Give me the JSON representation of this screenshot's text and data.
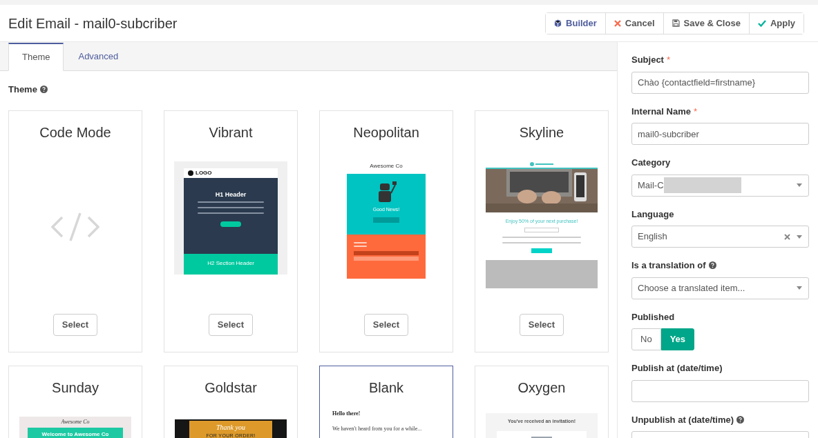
{
  "header": {
    "title": "Edit Email - mail0-subcriber",
    "buttons": [
      {
        "kind": "builder",
        "label": "Builder"
      },
      {
        "kind": "cancel",
        "label": "Cancel"
      },
      {
        "kind": "save",
        "label": "Save & Close"
      },
      {
        "kind": "apply",
        "label": "Apply"
      }
    ]
  },
  "tabs": [
    {
      "label": "Theme",
      "selected": true
    },
    {
      "label": "Advanced",
      "selected": false
    }
  ],
  "theme_label": "Theme",
  "themes": [
    {
      "name": "Code Mode",
      "kind": "code",
      "selected": false,
      "button": "Select"
    },
    {
      "name": "Vibrant",
      "kind": "vibrant",
      "selected": false,
      "button": "Select",
      "texts": [
        "LOGO",
        "H1 Header",
        "H2 Section Header"
      ]
    },
    {
      "name": "Neopolitan",
      "kind": "neopolitan",
      "selected": false,
      "button": "Select",
      "texts": [
        "Awesome Co",
        "Good News!"
      ]
    },
    {
      "name": "Skyline",
      "kind": "skyline",
      "selected": false,
      "button": "Select",
      "texts": [
        "Enjoy 50% of your next purchase!"
      ]
    },
    {
      "name": "Sunday",
      "kind": "sunday",
      "selected": false,
      "texts": [
        "Awesome Co",
        "Welcome to Awesome Co"
      ]
    },
    {
      "name": "Goldstar",
      "kind": "goldstar",
      "selected": false,
      "texts": [
        "Thank you",
        "FOR YOUR ORDER!"
      ]
    },
    {
      "name": "Blank",
      "kind": "blank",
      "selected": true,
      "texts": [
        "Hello there!",
        "We haven't heard from you for a while..."
      ]
    },
    {
      "name": "Oxygen",
      "kind": "oxygen",
      "selected": false,
      "texts": [
        "You've received an invitation!"
      ]
    }
  ],
  "form": [
    {
      "kind": "text",
      "label": "Subject",
      "required_mark": "*",
      "value": "Chào {contactfield=firstname}"
    },
    {
      "kind": "text",
      "label": "Internal Name",
      "required_mark": "*",
      "value": "mail0-subcriber"
    },
    {
      "kind": "select",
      "label": "Category",
      "value": "Mail-C",
      "redacted": true
    },
    {
      "kind": "select",
      "label": "Language",
      "value": "English",
      "clearable": true
    },
    {
      "kind": "select",
      "label": "Is a translation of",
      "help": true,
      "placeholder": "Choose a translated item..."
    },
    {
      "kind": "toggle",
      "label": "Published",
      "options": [
        {
          "label": "No",
          "selected": false
        },
        {
          "label": "Yes",
          "selected": true
        }
      ]
    },
    {
      "kind": "text",
      "label": "Publish at (date/time)"
    },
    {
      "kind": "text",
      "label": "Unpublish at (date/time)",
      "help": true
    }
  ]
}
